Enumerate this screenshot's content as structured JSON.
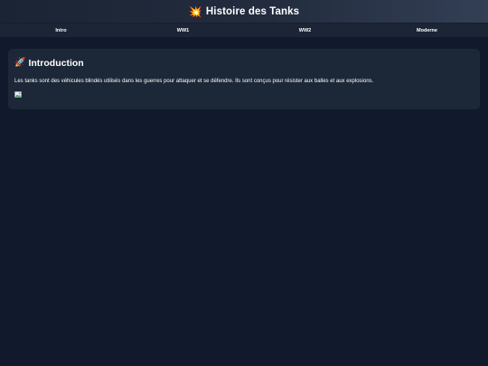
{
  "header": {
    "emoji": "💥",
    "title": "Histoire des Tanks"
  },
  "nav": {
    "items": [
      {
        "label": "Intro"
      },
      {
        "label": "WW1"
      },
      {
        "label": "WW2"
      },
      {
        "label": "Moderne"
      }
    ]
  },
  "intro": {
    "emoji": "🚀",
    "heading": "Introduction",
    "text": "Les tanks sont des véhicules blindés utilisés dans les guerres pour attaquer et se défendre. Ils sont conçus pour résister aux balles et aux explosions.",
    "image_icon": "broken-image-icon"
  },
  "colors": {
    "background": "#111a2c",
    "header": "#222c3e",
    "nav": "#1b2535",
    "card": "#1c2738"
  }
}
